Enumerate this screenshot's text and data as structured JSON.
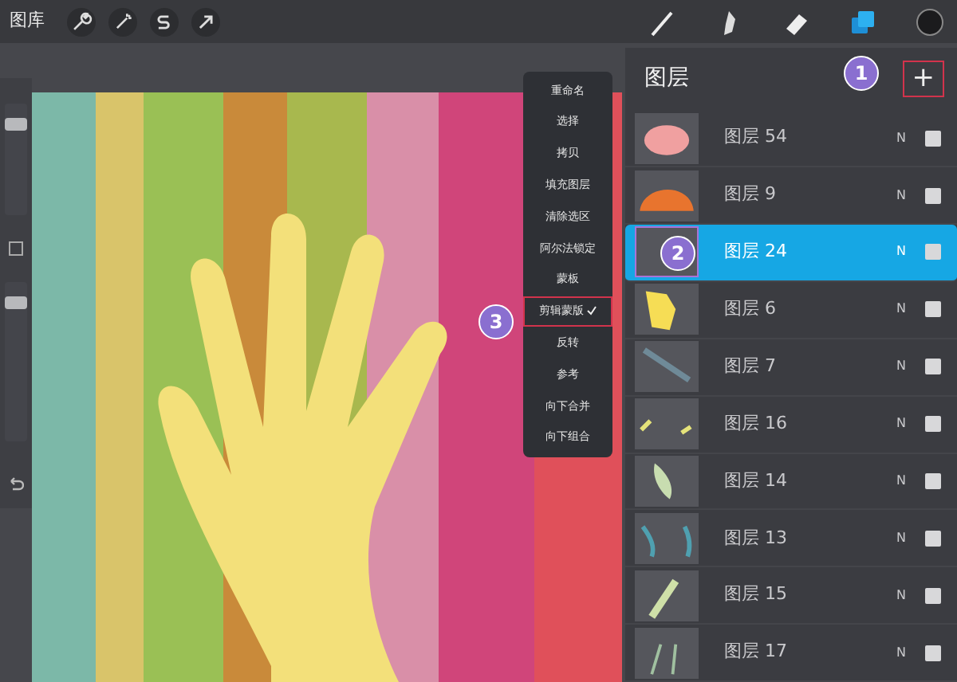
{
  "toolbar": {
    "gallery": "图库"
  },
  "side_toolbar": {
    "brush_size": {
      "level": 0.85
    },
    "opacity": {
      "level": 0.9
    }
  },
  "layer_menu": [
    {
      "label": "重命名",
      "checked": false,
      "outlined": false
    },
    {
      "label": "选择",
      "checked": false,
      "outlined": false
    },
    {
      "label": "拷贝",
      "checked": false,
      "outlined": false
    },
    {
      "label": "填充图层",
      "checked": false,
      "outlined": false
    },
    {
      "label": "清除选区",
      "checked": false,
      "outlined": false
    },
    {
      "label": "阿尔法锁定",
      "checked": false,
      "outlined": false
    },
    {
      "label": "蒙板",
      "checked": false,
      "outlined": false
    },
    {
      "label": "剪辑蒙版",
      "checked": true,
      "outlined": true
    },
    {
      "label": "反转",
      "checked": false,
      "outlined": false
    },
    {
      "label": "参考",
      "checked": false,
      "outlined": false
    },
    {
      "label": "向下合并",
      "checked": false,
      "outlined": false
    },
    {
      "label": "向下组合",
      "checked": false,
      "outlined": false
    }
  ],
  "layers_panel": {
    "title": "图层",
    "add_button": "+",
    "add_outlined": true,
    "layers": [
      {
        "name": "图层 54",
        "blend": "N",
        "visible": true,
        "selected": false,
        "outlined": false
      },
      {
        "name": "图层 9",
        "blend": "N",
        "visible": true,
        "selected": false,
        "outlined": false
      },
      {
        "name": "图层 24",
        "blend": "N",
        "visible": true,
        "selected": true,
        "outlined": true
      },
      {
        "name": "图层 6",
        "blend": "N",
        "visible": true,
        "selected": false,
        "outlined": false
      },
      {
        "name": "图层 7",
        "blend": "N",
        "visible": true,
        "selected": false,
        "outlined": false
      },
      {
        "name": "图层 16",
        "blend": "N",
        "visible": true,
        "selected": false,
        "outlined": false
      },
      {
        "name": "图层 14",
        "blend": "N",
        "visible": true,
        "selected": false,
        "outlined": false
      },
      {
        "name": "图层 13",
        "blend": "N",
        "visible": true,
        "selected": false,
        "outlined": false
      },
      {
        "name": "图层 15",
        "blend": "N",
        "visible": true,
        "selected": false,
        "outlined": false
      },
      {
        "name": "图层 17",
        "blend": "N",
        "visible": true,
        "selected": false,
        "outlined": false
      }
    ]
  },
  "callouts": [
    {
      "label": "1"
    },
    {
      "label": "2"
    },
    {
      "label": "3"
    }
  ]
}
